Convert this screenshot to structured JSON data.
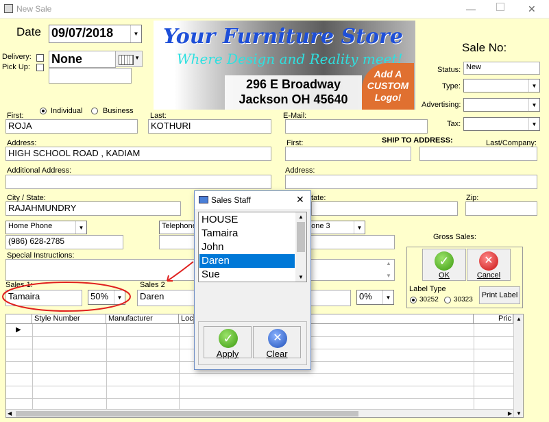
{
  "window": {
    "title": "New Sale"
  },
  "date": {
    "label": "Date",
    "value": "09/07/2018"
  },
  "delivery": {
    "delivery_label": "Delivery:",
    "pickup_label": "Pick Up:",
    "value": "None"
  },
  "banner": {
    "title": "Your Furniture Store",
    "tagline": "Where Design and Reality meet!",
    "address1": "296 E Broadway",
    "address2": "Jackson OH 45640",
    "logo_text": "Add A CUSTOM Logo!"
  },
  "sale": {
    "sale_no_label": "Sale No:",
    "status_label": "Status:",
    "status_value": "New",
    "type_label": "Type:",
    "type_value": "",
    "advertising_label": "Advertising:",
    "advertising_value": "",
    "tax_label": "Tax:",
    "tax_value": ""
  },
  "customer": {
    "first_label": "First:",
    "first_value": "ROJA",
    "individual_label": "Individual",
    "business_label": "Business",
    "last_label": "Last:",
    "last_value": "KOTHURI",
    "email_label": "E-Mail:",
    "email_value": "",
    "address_label": "Address:",
    "address_value": "HIGH SCHOOL ROAD , KADIAM",
    "additional_address_label": "Additional Address:",
    "additional_address_value": "",
    "city_state_label": "City / State:",
    "city_state_value": "RAJAHMUNDRY",
    "phone_type1": "Home Phone",
    "phone_value1": "(986) 628-2785",
    "phone_type2": "Telephone",
    "phone_type3": "hone 3",
    "special_instructions_label": "Special Instructions:",
    "special_instructions_value": ""
  },
  "ship_to": {
    "header": "SHIP TO ADDRESS:",
    "first_label": "First:",
    "last_label": "Last/Company:",
    "address_label": "Address:",
    "state_label": "tate:",
    "zip_label": "Zip:"
  },
  "sales_people": {
    "sales1_label": "Sales 1:",
    "sales1_value": "Tamaira",
    "sales1_pct": "50%",
    "sales2_label": "Sales 2",
    "sales2_value": "Daren",
    "sales3_pct": "0%"
  },
  "actions": {
    "gross_sales_label": "Gross Sales:",
    "ok_label": "OK",
    "cancel_label": "Cancel",
    "label_type_label": "Label Type",
    "label_opt1": "30252",
    "label_opt2": "30323",
    "print_label": "Print Label"
  },
  "items_grid": {
    "columns": [
      "Style Number",
      "Manufacturer",
      "Loc",
      "Pric"
    ]
  },
  "sales_staff_dialog": {
    "title": "Sales Staff",
    "items": [
      "HOUSE",
      "Tamaira",
      "John",
      "Daren",
      "Sue"
    ],
    "selected": "Daren",
    "apply_label": "Apply",
    "clear_label": "Clear"
  },
  "colors": {
    "form_bg": "#ffffcc",
    "selection": "#0078d7",
    "annotation": "#e0201e",
    "ok_green": "#4caf20",
    "cancel_red": "#d81e1e",
    "clear_blue": "#1e4fb8"
  }
}
